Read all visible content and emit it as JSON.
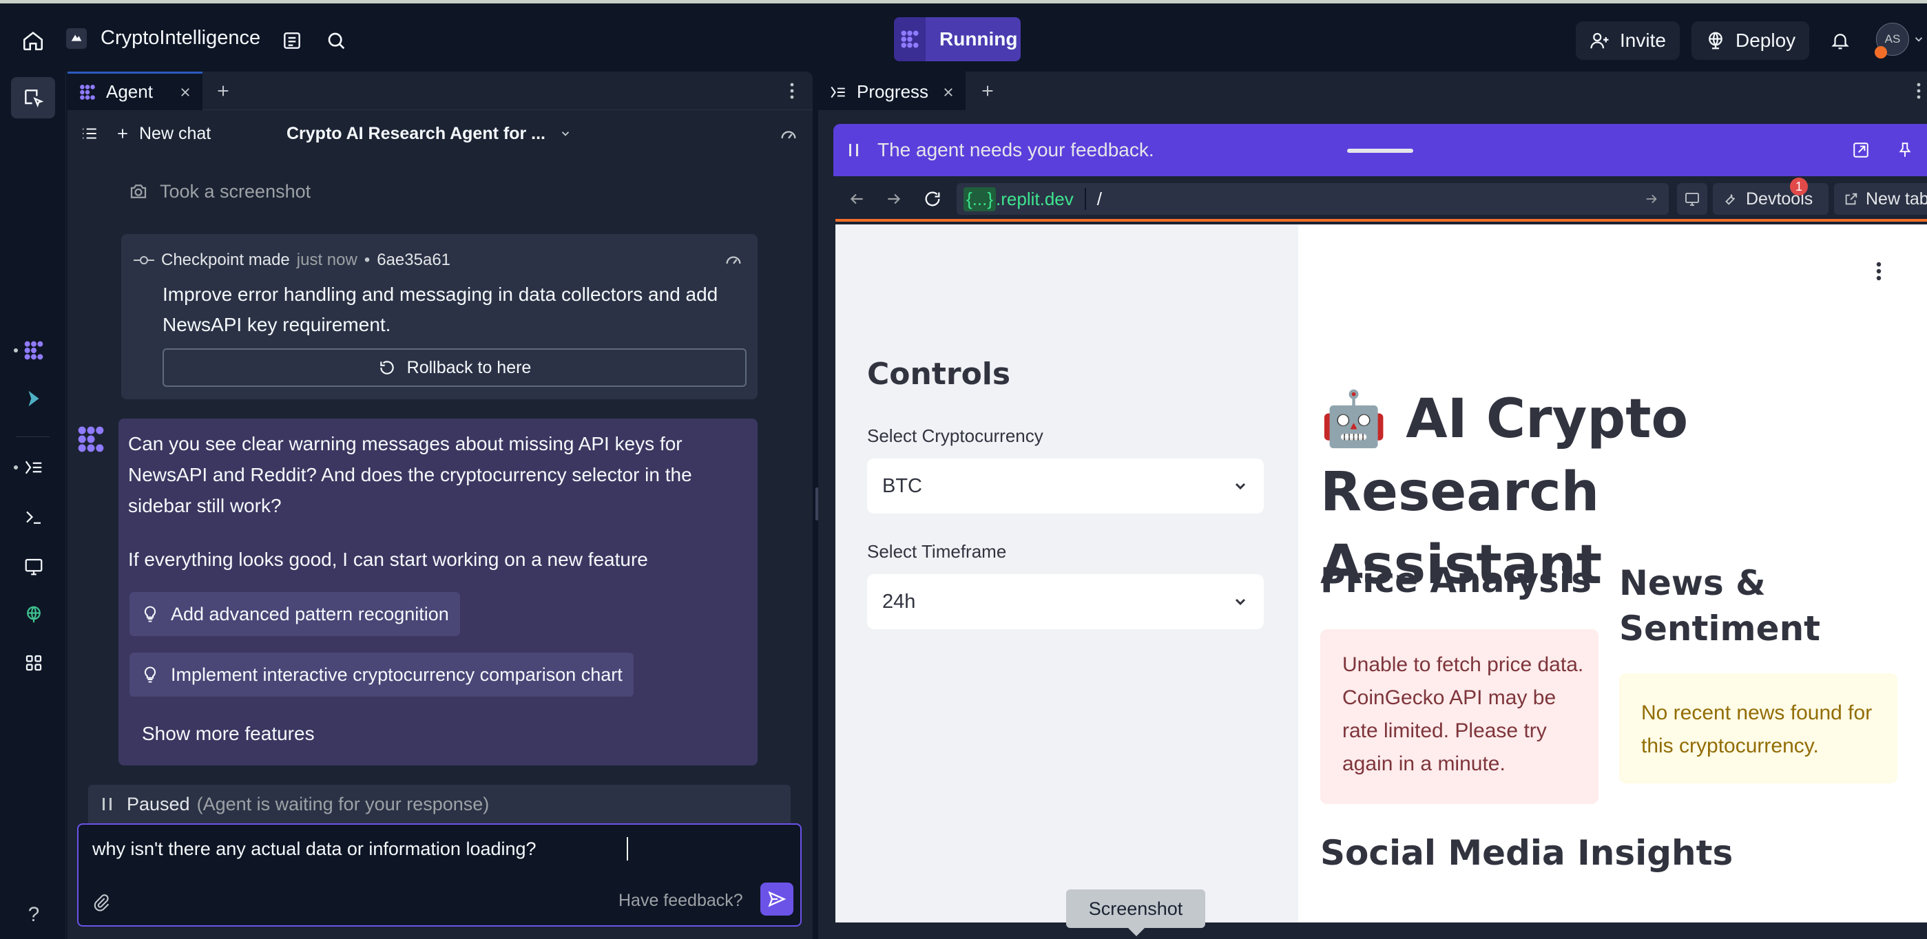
{
  "topbar": {
    "project_name": "CryptoIntelligence",
    "run_status": "Running",
    "invite_label": "Invite",
    "deploy_label": "Deploy",
    "avatar_initials": "AS"
  },
  "agent": {
    "tab_label": "Agent",
    "new_chat_label": "New chat",
    "chat_title": "Crypto AI Research Agent for ...",
    "screenshot_action": "Took a screenshot",
    "checkpoint": {
      "label": "Checkpoint made",
      "time": "just now",
      "separator": "•",
      "hash": "6ae35a61",
      "description": "Improve error handling and messaging in data collectors and add NewsAPI key requirement.",
      "rollback_label": "Rollback to here"
    },
    "message": {
      "question": "Can you see clear warning messages about missing API keys for NewsAPI and Reddit? And does the cryptocurrency selector in the sidebar still work?",
      "followup": "If everything looks good, I can start working on a new feature",
      "suggestions": [
        "Add advanced pattern recognition",
        "Implement interactive cryptocurrency comparison chart"
      ],
      "show_more_label": "Show more features"
    },
    "status": {
      "label": "Paused",
      "detail": "(Agent is waiting for your response)"
    },
    "input": {
      "value": "why isn't there any actual data or information loading?",
      "feedback_label": "Have feedback?"
    }
  },
  "progress": {
    "tab_label": "Progress",
    "feedback_banner": "The agent needs your feedback.",
    "url_badge": "{...}",
    "url_domain": ".replit.dev",
    "url_path": "/",
    "devtools_label": "Devtools",
    "devtools_badge": "1",
    "new_tab_label": "New tab"
  },
  "app": {
    "sidebar_title": "Controls",
    "crypto_label": "Select Cryptocurrency",
    "crypto_value": "BTC",
    "timeframe_label": "Select Timeframe",
    "timeframe_value": "24h",
    "title_emoji": "🤖",
    "title_line1": "AI Crypto Research",
    "title_line2": "Assistant",
    "price_heading": "Price Analysis",
    "price_error": "Unable to fetch price data. CoinGecko API may be rate limited. Please try again in a minute.",
    "news_heading": "News & Sentiment",
    "news_warning": "No recent news found for this cryptocurrency.",
    "social_heading": "Social Media Insights"
  },
  "tooltip": {
    "label": "Screenshot"
  },
  "colors": {
    "accent": "#6b53e8",
    "error_bg": "#ffecec",
    "error_text": "#7d353b",
    "warning_bg": "#fffce7",
    "warning_text": "#926c05",
    "url_green": "#2fbf71"
  }
}
